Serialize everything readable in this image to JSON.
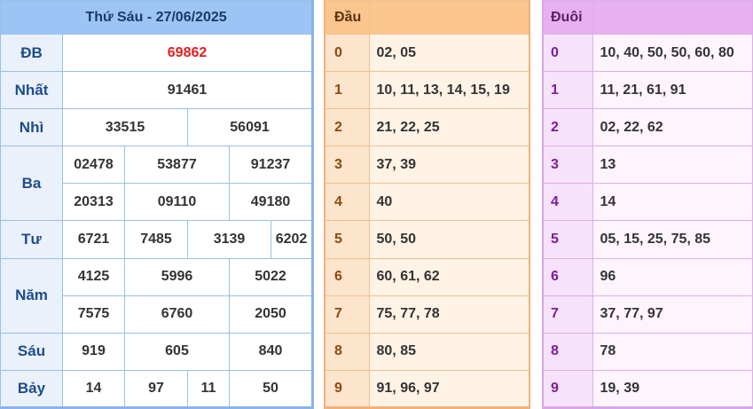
{
  "results": {
    "header": "Thứ Sáu - 27/06/2025",
    "db": {
      "label": "ĐB",
      "value": "69862"
    },
    "nhat": {
      "label": "Nhất",
      "value": "91461"
    },
    "nhi": {
      "label": "Nhì",
      "values": [
        "33515",
        "56091"
      ]
    },
    "ba": {
      "label": "Ba",
      "values": [
        "02478",
        "53877",
        "91237",
        "20313",
        "09110",
        "49180"
      ]
    },
    "tu": {
      "label": "Tư",
      "values": [
        "6721",
        "7485",
        "3139",
        "6202"
      ]
    },
    "nam": {
      "label": "Năm",
      "values": [
        "4125",
        "5996",
        "5022",
        "7575",
        "6760",
        "2050"
      ]
    },
    "sau": {
      "label": "Sáu",
      "values": [
        "919",
        "605",
        "840"
      ]
    },
    "bay": {
      "label": "Bảy",
      "values": [
        "14",
        "97",
        "11",
        "50"
      ]
    }
  },
  "dau": {
    "header": "Đầu",
    "rows": [
      {
        "key": "0",
        "values": "02, 05"
      },
      {
        "key": "1",
        "values": "10, 11, 13, 14, 15, 19"
      },
      {
        "key": "2",
        "values": "21, 22, 25"
      },
      {
        "key": "3",
        "values": "37, 39"
      },
      {
        "key": "4",
        "values": "40"
      },
      {
        "key": "5",
        "values": "50, 50"
      },
      {
        "key": "6",
        "values": "60, 61, 62"
      },
      {
        "key": "7",
        "values": "75, 77, 78"
      },
      {
        "key": "8",
        "values": "80, 85"
      },
      {
        "key": "9",
        "values": "91, 96, 97"
      }
    ]
  },
  "duoi": {
    "header": "Đuôi",
    "rows": [
      {
        "key": "0",
        "values": "10, 40, 50, 50, 60, 80"
      },
      {
        "key": "1",
        "values": "11, 21, 61, 91"
      },
      {
        "key": "2",
        "values": "02, 22, 62"
      },
      {
        "key": "3",
        "values": "13"
      },
      {
        "key": "4",
        "values": "14"
      },
      {
        "key": "5",
        "values": "05, 15, 25, 75, 85"
      },
      {
        "key": "6",
        "values": "96"
      },
      {
        "key": "7",
        "values": "37, 77, 97"
      },
      {
        "key": "8",
        "values": "78"
      },
      {
        "key": "9",
        "values": "19, 39"
      }
    ]
  },
  "colors": {
    "special_prize": "#e02020",
    "results_header": "#9cc4f5",
    "dau_header": "#fbc68e",
    "duoi_header": "#e6b1ee"
  }
}
